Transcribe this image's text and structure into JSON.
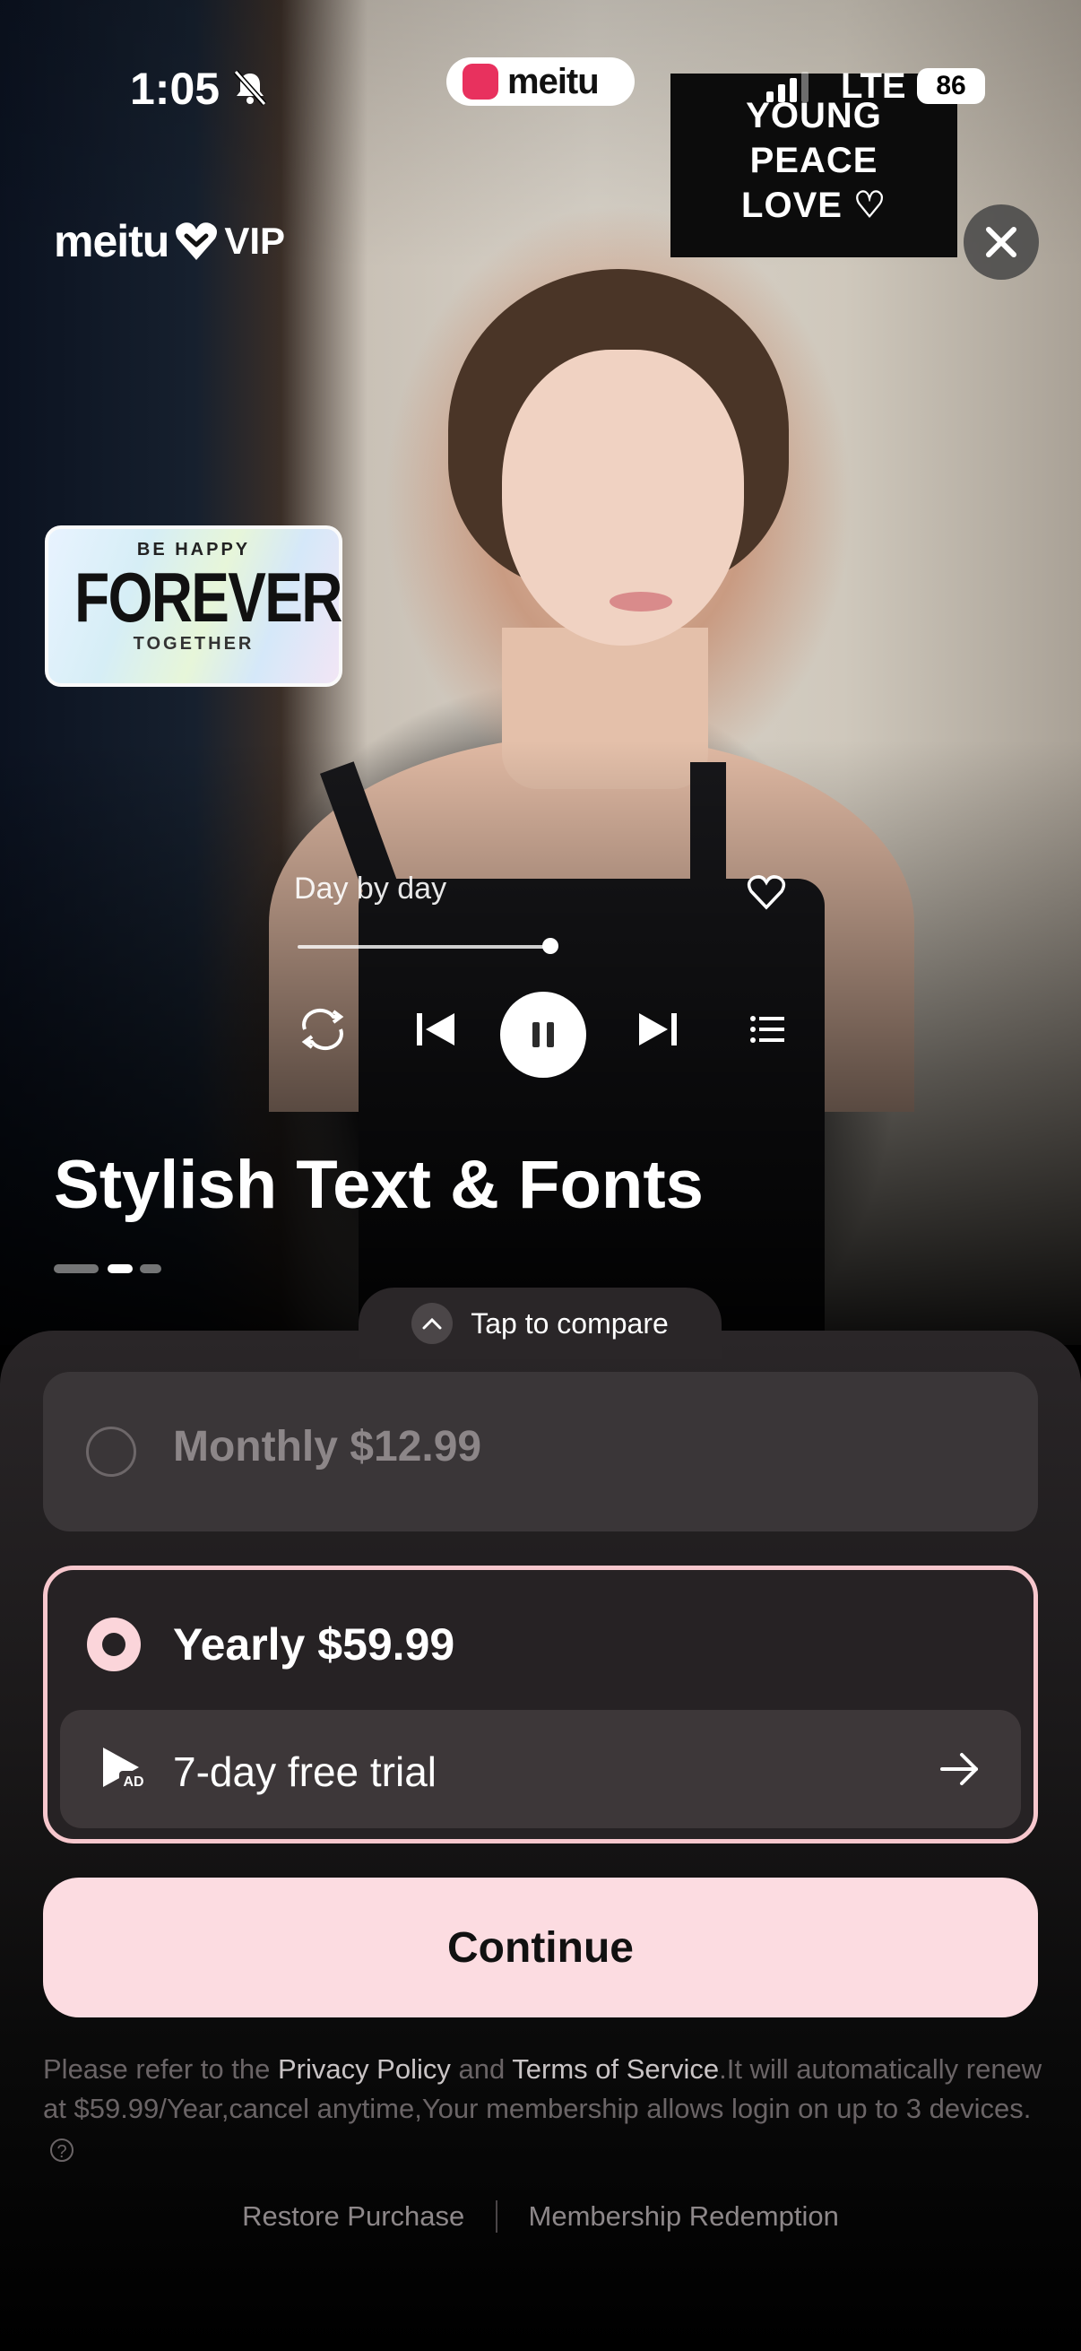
{
  "status_bar": {
    "time": "1:05",
    "lte": "LTE",
    "battery": "86"
  },
  "app_pill": {
    "name": "meitu"
  },
  "brand": {
    "name": "meitu",
    "tier": "VIP"
  },
  "stickers": {
    "young": [
      "YOUNG",
      "PEACE",
      "LOVE ♡"
    ],
    "plate": {
      "top": "BE HAPPY",
      "main": "FOREVER",
      "bottom": "TOGETHER"
    }
  },
  "player": {
    "song": "Day by day",
    "progress": 0.88
  },
  "feature": {
    "title": "Stylish Text & Fonts",
    "page_index": 1,
    "page_count": 3
  },
  "compare": {
    "label": "Tap to compare"
  },
  "plans": {
    "monthly": {
      "label": "Monthly $12.99",
      "selected": false
    },
    "yearly": {
      "label": "Yearly $59.99",
      "selected": true,
      "trial_label": "7-day free trial"
    }
  },
  "cta": {
    "continue_label": "Continue"
  },
  "legal": {
    "prefix": "Please refer to the ",
    "privacy": "Privacy Policy",
    "and": " and ",
    "terms": "Terms of Service",
    "suffix": ".It will automatically renew at $59.99/Year,cancel anytime,Your membership allows login on up to 3 devices."
  },
  "footer": {
    "restore": "Restore Purchase",
    "redeem": "Membership Redemption"
  },
  "colors": {
    "accent": "#fcdce1",
    "selected_border": "#f7c7cd",
    "brand_red": "#e8315e"
  }
}
